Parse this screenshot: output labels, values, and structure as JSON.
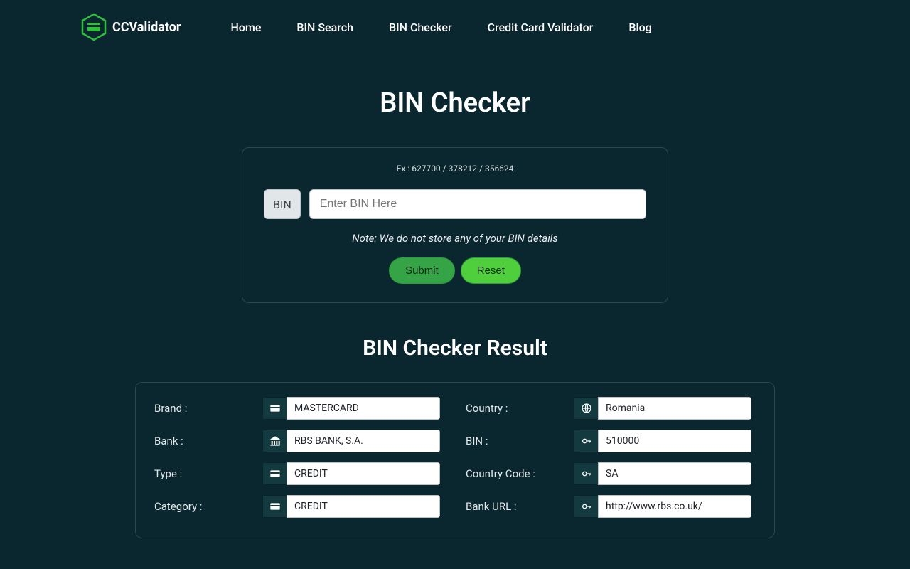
{
  "brand": "CCValidator",
  "nav": [
    "Home",
    "BIN Search",
    "BIN Checker",
    "Credit Card Validator",
    "Blog"
  ],
  "page_title": "BIN Checker",
  "form": {
    "example": "Ex : 627700 / 378212 / 356624",
    "prefix": "BIN",
    "placeholder": "Enter BIN Here",
    "note": "Note: We do not store any of your BIN details",
    "submit": "Submit",
    "reset": "Reset"
  },
  "result_title": "BIN Checker Result",
  "result": {
    "left": [
      {
        "label": "Brand :",
        "icon": "card",
        "value": "MASTERCARD"
      },
      {
        "label": "Bank :",
        "icon": "bank",
        "value": "RBS BANK, S.A."
      },
      {
        "label": "Type :",
        "icon": "card",
        "value": "CREDIT"
      },
      {
        "label": "Category :",
        "icon": "card",
        "value": "CREDIT"
      }
    ],
    "right": [
      {
        "label": "Country :",
        "icon": "globe",
        "value": "Romania"
      },
      {
        "label": "BIN :",
        "icon": "key",
        "value": "510000"
      },
      {
        "label": "Country Code :",
        "icon": "key",
        "value": "SA"
      },
      {
        "label": "Bank URL :",
        "icon": "key",
        "value": "http://www.rbs.co.uk/"
      }
    ]
  }
}
